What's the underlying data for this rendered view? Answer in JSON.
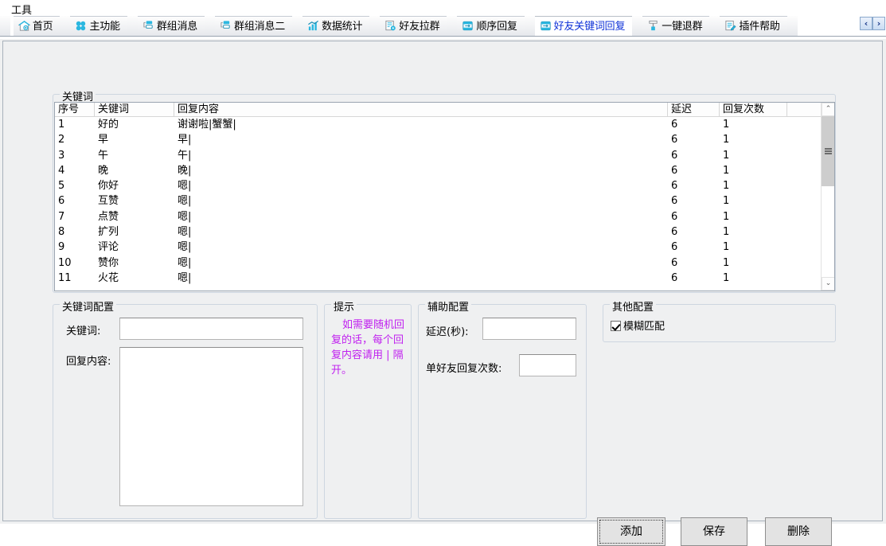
{
  "menubar": {
    "tool_label": "工具"
  },
  "tabs": {
    "items": [
      {
        "label": "首页",
        "icon": "home-icon",
        "active": false
      },
      {
        "label": "主功能",
        "icon": "grid-dots-icon",
        "active": false
      },
      {
        "label": "群组消息",
        "icon": "group-message-icon",
        "active": false
      },
      {
        "label": "群组消息二",
        "icon": "group-message-icon",
        "active": false
      },
      {
        "label": "数据统计",
        "icon": "chart-icon",
        "active": false
      },
      {
        "label": "好友拉群",
        "icon": "invite-group-icon",
        "active": false
      },
      {
        "label": "顺序回复",
        "icon": "reply-icon",
        "active": false
      },
      {
        "label": "好友关键词回复",
        "icon": "reply-icon",
        "active": true
      },
      {
        "label": "一键退群",
        "icon": "exit-group-icon",
        "active": false
      },
      {
        "label": "插件帮助",
        "icon": "help-doc-icon",
        "active": false
      }
    ],
    "nav_prev": "‹",
    "nav_next": "›",
    "active_color": "#1033d8"
  },
  "keyword_group": {
    "title": "关键词",
    "columns": [
      "序号",
      "关键词",
      "回复内容",
      "延迟",
      "回复次数",
      ""
    ],
    "rows": [
      {
        "idx": "1",
        "keyword": "好的",
        "reply": "谢谢啦|蟹蟹|",
        "delay": "6",
        "times": "1"
      },
      {
        "idx": "2",
        "keyword": "早",
        "reply": "早|",
        "delay": "6",
        "times": "1"
      },
      {
        "idx": "3",
        "keyword": "午",
        "reply": "午|",
        "delay": "6",
        "times": "1"
      },
      {
        "idx": "4",
        "keyword": "晚",
        "reply": "晚|",
        "delay": "6",
        "times": "1"
      },
      {
        "idx": "5",
        "keyword": "你好",
        "reply": "嗯|",
        "delay": "6",
        "times": "1"
      },
      {
        "idx": "6",
        "keyword": "互赞",
        "reply": "嗯|",
        "delay": "6",
        "times": "1"
      },
      {
        "idx": "7",
        "keyword": "点赞",
        "reply": "嗯|",
        "delay": "6",
        "times": "1"
      },
      {
        "idx": "8",
        "keyword": "扩列",
        "reply": "嗯|",
        "delay": "6",
        "times": "1"
      },
      {
        "idx": "9",
        "keyword": "评论",
        "reply": "嗯|",
        "delay": "6",
        "times": "1"
      },
      {
        "idx": "10",
        "keyword": "赞你",
        "reply": "嗯|",
        "delay": "6",
        "times": "1"
      },
      {
        "idx": "11",
        "keyword": "火花",
        "reply": "嗯|",
        "delay": "6",
        "times": "1"
      }
    ],
    "scroll_up": "⌃",
    "scroll_down": "⌄"
  },
  "keyword_config": {
    "title": "关键词配置",
    "keyword_label": "关键词:",
    "keyword_value": "",
    "reply_label": "回复内容:",
    "reply_value": ""
  },
  "hint": {
    "title": "提示",
    "text": "如需要随机回复的话，每个回复内容请用 | 隔开。",
    "color": "#c020f0"
  },
  "aux_config": {
    "title": "辅助配置",
    "delay_label": "延迟(秒):",
    "delay_value": "",
    "times_label": "单好友回复次数:",
    "times_value": ""
  },
  "other_config": {
    "title": "其他配置",
    "fuzzy_label": "模糊匹配",
    "fuzzy_checked": true
  },
  "buttons": {
    "add": "添加",
    "save": "保存",
    "delete": "删除"
  }
}
